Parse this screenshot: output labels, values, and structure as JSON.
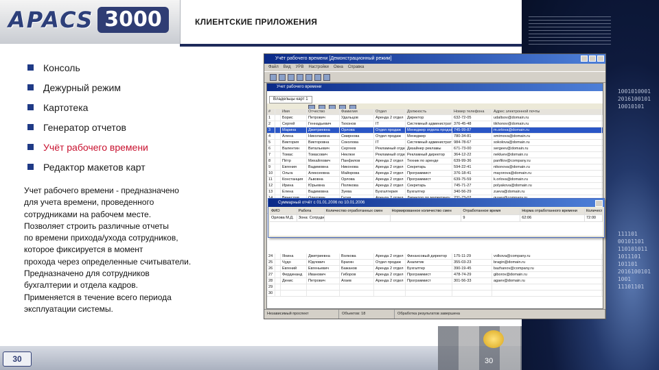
{
  "header": {
    "logo_text": "APACS",
    "logo_number": "3000",
    "section_title": "КЛИЕНТСКИЕ ПРИЛОЖЕНИЯ"
  },
  "bullets": [
    "Консоль",
    "Дежурный режим",
    "Картотека",
    "Генератор отчетов",
    "Учёт рабочего времени",
    "Редактор макетов карт"
  ],
  "active_bullet": "Учёт рабочего времени",
  "description_lines": [
    "Учет рабочего времени - предназначено",
    "для учета времени, проведенного",
    "сотрудниками на рабочем месте.",
    "Позволяет строить различные отчеты",
    "по времени прихода/ухода сотрудников,",
    "которое фиксируется в момент",
    "прохода через определенные считыватели.",
    "Предназначено для сотрудников",
    "бухгалтерии и отдела кадров.",
    "Применяется в течение всего периода",
    "эксплуатации системы."
  ],
  "app_window": {
    "title": "Учёт рабочего времени [Демонстрационный режим]",
    "menu": [
      "Файл",
      "Вид",
      "УРВ",
      "Настройки",
      "Окна",
      "Справка"
    ],
    "inner_title": "Учет рабочего времени",
    "tab_label": "Владельцы карт 1",
    "columns": [
      "#",
      "",
      "Имя",
      "Отчество",
      "Фамилия",
      "Отдел",
      "Должность",
      "Номер телефона",
      "Адрес электронной почты"
    ],
    "rows": [
      [
        "1",
        "Борис",
        "Петрович",
        "Удальцов",
        "Аренда 2 отдел",
        "Директор",
        "632-72-05",
        "udaltsov@domain.ru"
      ],
      [
        "2",
        "Сергей",
        "Геннадьевич",
        "Тихонов",
        "IT",
        "Системный администратор",
        "376-45-48",
        "tikhonov@domain.ru"
      ],
      [
        "3",
        "Марина",
        "Дмитриевна",
        "Орлова",
        "Отдел продаж",
        "Менеджер отдела продаж",
        "745-99-87",
        "m.orlova@domain.ru"
      ],
      [
        "4",
        "Алена",
        "Николаевна",
        "Смирнова",
        "Отдел продаж",
        "Менеджер",
        "780-34-81",
        "smirnova@domain.ru"
      ],
      [
        "5",
        "Виктория",
        "Викторовна",
        "Соколова",
        "IT",
        "Системный администратор",
        "984-78-67",
        "sokolova@domain.ru"
      ],
      [
        "6",
        "Валентин",
        "Витальевич",
        "Сергеев",
        "Рекламный отдел",
        "Дизайнер рекламы",
        "671-73-00",
        "sergeev@domain.ru"
      ],
      [
        "7",
        "Томас",
        "Томасович",
        "Неклюе",
        "Рекламный отдел",
        "Рекламный директор",
        "364-12-22",
        "nekluev@domain.ru"
      ],
      [
        "8",
        "Пётр",
        "Михайлович",
        "Панфилов",
        "Аренда 2 отдел",
        "Техник по аренде",
        "639-99-36",
        "panfilov@company.ru"
      ],
      [
        "9",
        "Евгения",
        "Вадимовна",
        "Никонова",
        "Аренда 2 отдел",
        "Секретарь",
        "594-22-41",
        "nikonova@domain.ru"
      ],
      [
        "10",
        "Ольга",
        "Алексеевна",
        "Майорова",
        "Аренда 2 отдел",
        "Программист",
        "376-18-41",
        "mayorova@domain.ru"
      ],
      [
        "11",
        "Констанция",
        "Львовна",
        "Орлова",
        "Аренда 2 отдел",
        "Программист",
        "639-75-59",
        "k.orlova@domain.ru"
      ],
      [
        "12",
        "Ирина",
        "Юрьевна",
        "Полякова",
        "Аренда 2 отдел",
        "Секретарь",
        "745-71-27",
        "polyakova@domain.ru"
      ],
      [
        "13",
        "Елена",
        "Вадимовна",
        "Зуева",
        "Бухгалтерия",
        "Бухгалтер",
        "340-56-29",
        "zueva@domain.ru"
      ],
      [
        "14",
        "Вячеслав",
        "Олегович",
        "Гусев",
        "Аренда 2 отдел",
        "Директор по маркетингу",
        "231-73-02",
        "gusev@company.ru"
      ],
      [
        "15",
        "Виталий",
        "Павлович",
        "Крылов",
        "Аренда 2 отдел",
        "Программист",
        "376-83-42",
        "krylov@domain.ru"
      ],
      [
        "16",
        "Евдокия",
        "Владимировна",
        "Титова",
        "Маркетинг",
        "Маркетолог",
        "965-39-91",
        "titova@domain.ru"
      ]
    ],
    "rows_below": [
      [
        "24",
        "Янина",
        "Дмитриевна",
        "Волкова",
        "Аренда 2 отдел",
        "Финансовый директор",
        "175-11-29",
        "volkova@company.ru"
      ],
      [
        "25",
        "Чудо",
        "Юдлович",
        "Брагин",
        "Отдел продаж",
        "Аналитик",
        "355-03-23",
        "bragin@domain.ru"
      ],
      [
        "26",
        "Евгений",
        "Евгеньевич",
        "Бажанов",
        "Аренда 2 отдел",
        "Бухгалтер",
        "390-19-45",
        "bazhanov@company.ru"
      ],
      [
        "27",
        "Фердинанд",
        "Иванович",
        "Гиборов",
        "Аренда 2 отдел",
        "Программист",
        "478-74-29",
        "giborov@domain.ru"
      ],
      [
        "28",
        "Денис",
        "Петрович",
        "Агаев",
        "Аренда 2 отдел",
        "Программист",
        "301-56-33",
        "agaev@domain.ru"
      ],
      [
        "29",
        "",
        "",
        "",
        "",
        "",
        "",
        ""
      ],
      [
        "30",
        "",
        "",
        "",
        "",
        "",
        "",
        ""
      ]
    ],
    "status": [
      "Независимый проспект",
      "Объектов: 18",
      "Обработка результатов завершена"
    ]
  },
  "report_window": {
    "title": "Суммарный отчёт с 01.01.2006 по 10.01.2006",
    "columns": [
      "ФИО",
      "Работа",
      "Количество отработанных смен",
      "Нормированное количество смен",
      "Отработанное время",
      "Норма отработанного времени",
      "Количество"
    ],
    "row": [
      "Орлова М.Д.",
      "Зона: Сотрудник",
      "",
      "",
      "9",
      "62:06",
      "72:00"
    ]
  },
  "side_binary": [
    "1001010001",
    "2016100101",
    "10010101",
    "1001",
    "10010101",
    "101"
  ],
  "side_binary_lower": [
    "111101",
    "00101101",
    "110101011",
    "1011101",
    "101101",
    "2016100101",
    "1001",
    "11101101"
  ],
  "footer": {
    "page_number": "30",
    "page_number_alt": "30"
  },
  "colors": {
    "brand_navy": "#2f3d74",
    "bullet": "#1f3a86",
    "active_bullet": "#c8102e",
    "selected_row": "#2a56c6"
  }
}
